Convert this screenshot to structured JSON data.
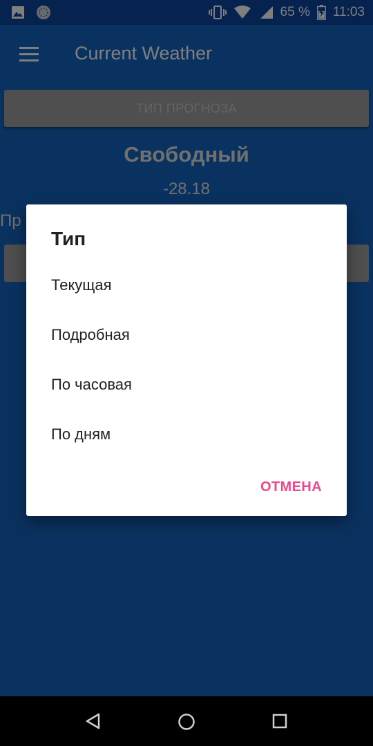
{
  "status_bar": {
    "icons_left": [
      "image-icon",
      "globe-icon"
    ],
    "battery_percent": "65 %",
    "time": "11:03"
  },
  "app_bar": {
    "title": "Current Weather"
  },
  "main": {
    "forecast_type_button": "ТИП ПРОГНОЗА",
    "location": "Свободный",
    "temperature": "-28.18",
    "partial_label": "Пр"
  },
  "dialog": {
    "title": "Тип",
    "options": [
      "Текущая",
      "Подробная",
      "По часовая",
      "По дням"
    ],
    "cancel": "ОТМЕНА"
  },
  "colors": {
    "primary": "#1565C0",
    "status_bar": "#0D47A1",
    "accent": "#E84A8A"
  }
}
